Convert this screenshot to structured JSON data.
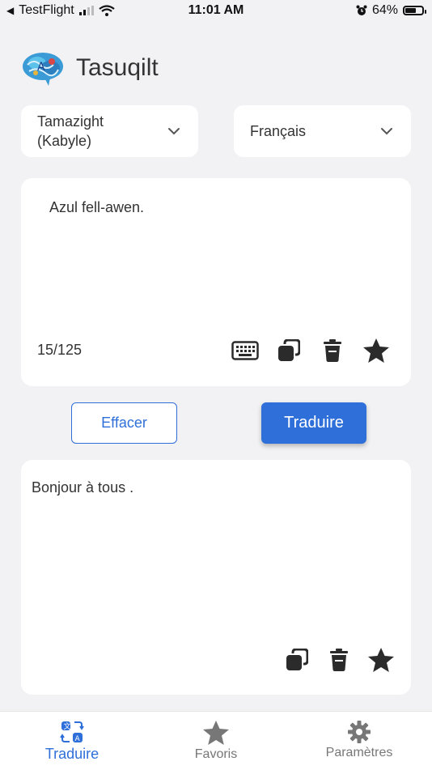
{
  "status_bar": {
    "back_app": "TestFlight",
    "time": "11:01 AM",
    "battery_percent": "64%",
    "battery_level": 0.64
  },
  "header": {
    "app_name": "Tasuqilt",
    "logo_text": "A"
  },
  "languages": {
    "source_line1": "Tamazight",
    "source_line2": "(Kabyle)",
    "target": "Français"
  },
  "source": {
    "text": "Azul fell-awen.",
    "counter": "15/125"
  },
  "actions": {
    "clear_label": "Effacer",
    "translate_label": "Traduire"
  },
  "output": {
    "text": "Bonjour à tous ."
  },
  "tabs": [
    {
      "label": "Traduire",
      "active": true
    },
    {
      "label": "Favoris",
      "active": false
    },
    {
      "label": "Paramètres",
      "active": false
    }
  ],
  "colors": {
    "accent": "#2f6fd9",
    "icon_dark": "#2b2b2b",
    "inactive_tab": "#777777"
  }
}
